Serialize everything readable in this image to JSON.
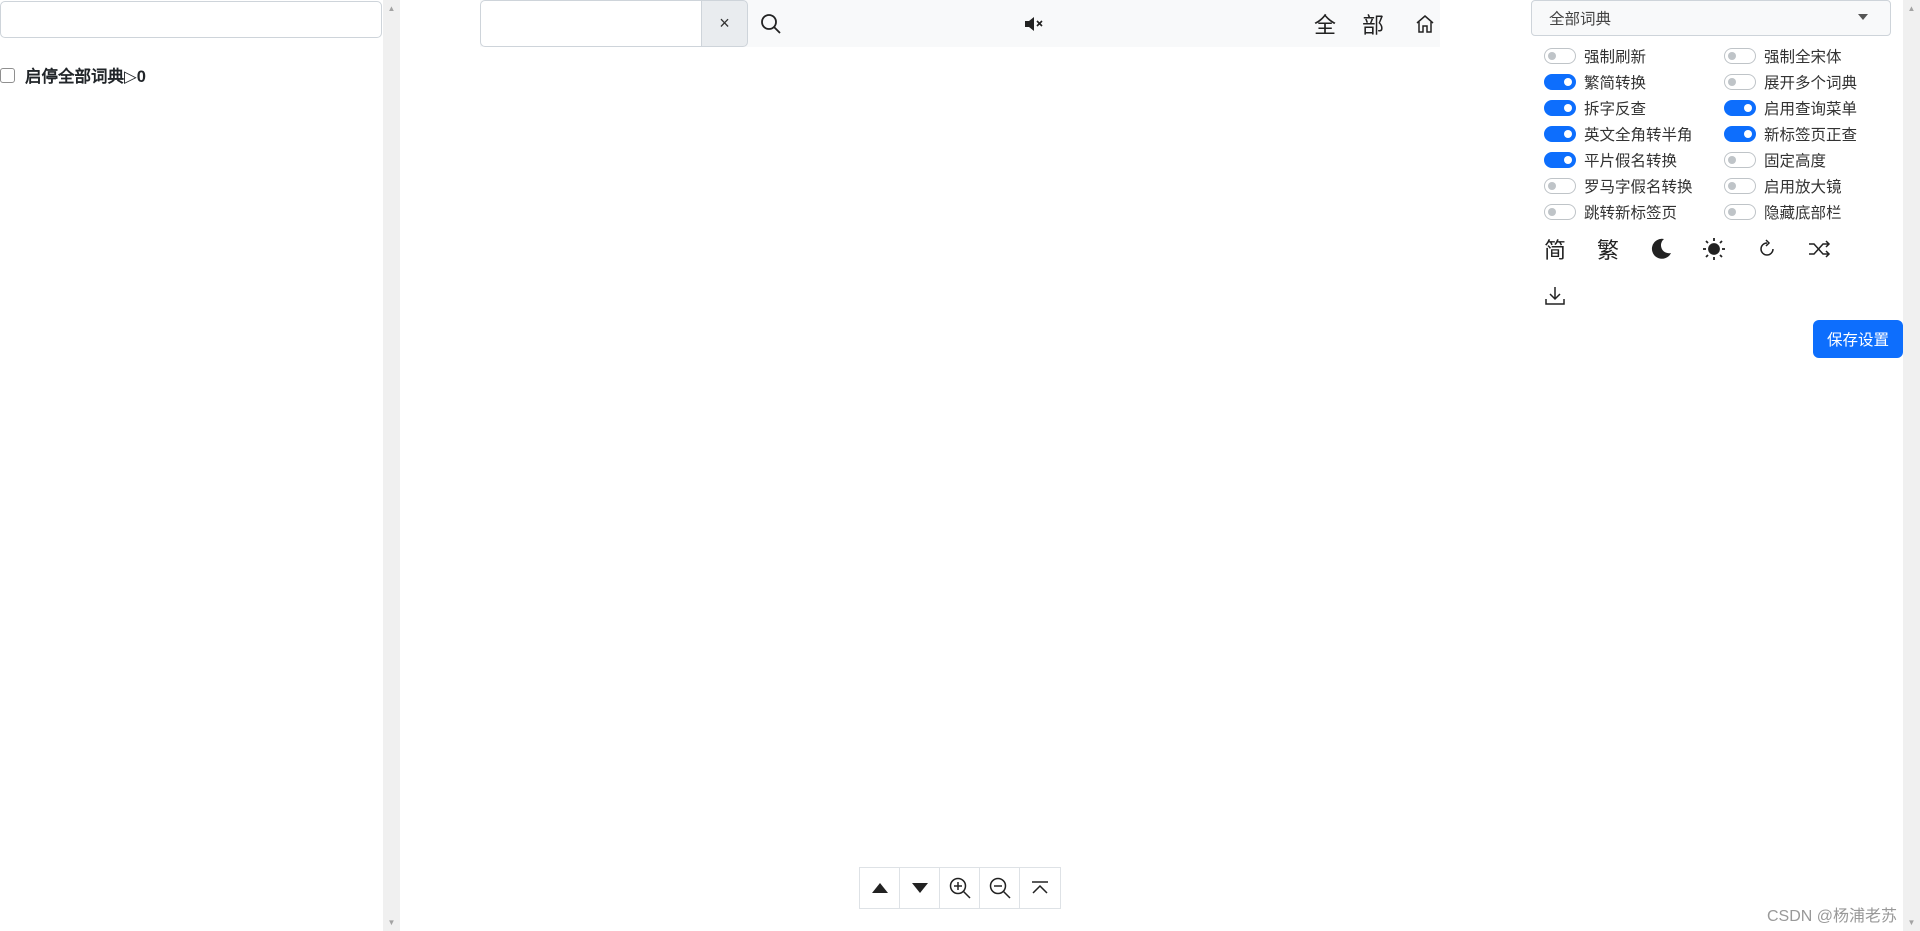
{
  "left_panel": {
    "filter_value": "",
    "toggle_all_label": "启停全部词典▷0",
    "toggle_all_checked": false
  },
  "topbar": {
    "search_value": "",
    "clear_label": "×",
    "all_label": "全",
    "part_label": "部",
    "icons": {
      "search": "search-icon",
      "mute": "volume-mute-icon",
      "home": "home-icon"
    }
  },
  "right_panel": {
    "dict_select": {
      "selected": "全部词典"
    },
    "switches": [
      {
        "label": "强制刷新",
        "on": false
      },
      {
        "label": "强制全宋体",
        "on": false
      },
      {
        "label": "繁简转换",
        "on": true
      },
      {
        "label": "展开多个词典",
        "on": false
      },
      {
        "label": "拆字反查",
        "on": true
      },
      {
        "label": "启用查询菜单",
        "on": true
      },
      {
        "label": "英文全角转半角",
        "on": true
      },
      {
        "label": "新标签页正查",
        "on": true
      },
      {
        "label": "平片假名转换",
        "on": true
      },
      {
        "label": "固定高度",
        "on": false
      },
      {
        "label": "罗马字假名转换",
        "on": false
      },
      {
        "label": "启用放大镜",
        "on": false
      },
      {
        "label": "跳转新标签页",
        "on": false
      },
      {
        "label": "隐藏底部栏",
        "on": false
      }
    ],
    "tools": {
      "simplified_label": "简",
      "traditional_label": "繁",
      "icons": [
        "moon-icon",
        "sun-icon",
        "refresh-icon",
        "shuffle-icon",
        "download-icon"
      ]
    },
    "save_label": "保存设置"
  },
  "bottom_nav": {
    "icons": [
      "prev-up-icon",
      "next-down-icon",
      "zoom-in-icon",
      "zoom-out-icon",
      "back-to-top-icon"
    ]
  },
  "watermark": "CSDN @杨浦老苏",
  "colors": {
    "accent": "#0d6efd",
    "topbar_bg": "#f8f9fa",
    "clear_btn_bg": "#e9ecef"
  }
}
